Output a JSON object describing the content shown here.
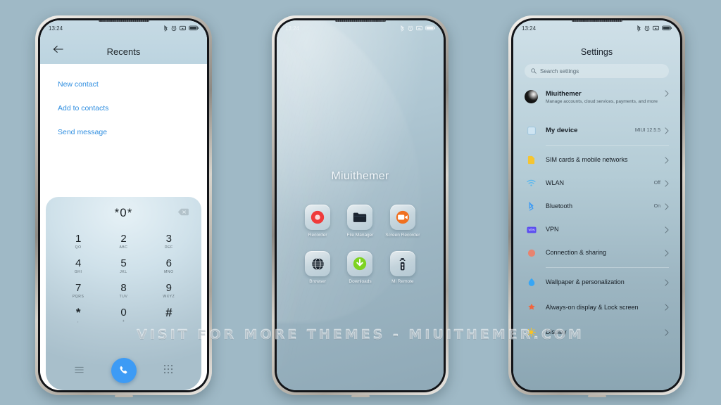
{
  "background_color": "#9fb9c6",
  "watermark": "VISIT FOR MORE THEMES - MIUITHEMER.COM",
  "status_bar": {
    "time": "13:24",
    "icons": [
      "bluetooth-icon",
      "alarm-icon",
      "screenshot-icon",
      "battery-icon"
    ]
  },
  "phone1": {
    "screen_name": "dialer-recents",
    "appbar": {
      "back_icon": "back-arrow-icon",
      "title": "Recents"
    },
    "menu_items": [
      {
        "label": "New contact"
      },
      {
        "label": "Add to contacts"
      },
      {
        "label": "Send message"
      }
    ],
    "menu_color": "#2f8ee0",
    "keypad": {
      "entered_number": "*0*",
      "delete_icon": "backspace-icon",
      "keys": [
        {
          "digit": "1",
          "letters": "QO"
        },
        {
          "digit": "2",
          "letters": "ABC"
        },
        {
          "digit": "3",
          "letters": "DEF"
        },
        {
          "digit": "4",
          "letters": "GHI"
        },
        {
          "digit": "5",
          "letters": "JKL"
        },
        {
          "digit": "6",
          "letters": "MNO"
        },
        {
          "digit": "7",
          "letters": "PQRS"
        },
        {
          "digit": "8",
          "letters": "TUV"
        },
        {
          "digit": "9",
          "letters": "WXYZ"
        },
        {
          "digit": "*",
          "letters": ","
        },
        {
          "digit": "0",
          "letters": "+"
        },
        {
          "digit": "#",
          "letters": ""
        }
      ],
      "left_icon": "menu-lines-icon",
      "call_icon": "phone-call-icon",
      "right_icon": "keypad-grid-icon",
      "call_button_color": "#3d9bf5"
    }
  },
  "phone2": {
    "screen_name": "home-screen",
    "wallpaper_title": "Miuithemer",
    "apps": [
      {
        "label": "Recorder",
        "icon": "recorder-icon",
        "color": "#ef3b3b"
      },
      {
        "label": "File Manager",
        "icon": "folder-icon",
        "color": "#1b2430"
      },
      {
        "label": "Screen Recorder",
        "icon": "screen-recorder-icon",
        "color": "#f07020"
      },
      {
        "label": "Browser",
        "icon": "globe-icon",
        "color": "#15202b"
      },
      {
        "label": "Downloads",
        "icon": "download-arrow-icon",
        "color": "#7ed321"
      },
      {
        "label": "Mi Remote",
        "icon": "remote-control-icon",
        "color": "#1b2430"
      }
    ]
  },
  "phone3": {
    "screen_name": "settings",
    "title": "Settings",
    "search": {
      "icon": "search-icon",
      "placeholder": "Search settings"
    },
    "account": {
      "avatar": "user-avatar",
      "name": "Miuithemer",
      "subtitle": "Manage accounts, cloud services, payments, and more",
      "chevron": "chevron-right-icon"
    },
    "device": {
      "icon": "device-icon",
      "label": "My device",
      "value": "MIUI 12.5.5",
      "chevron": "chevron-right-icon"
    },
    "items": [
      {
        "label": "SIM cards & mobile networks",
        "value": "",
        "icon": "sim-card-icon",
        "color": "#f5c531"
      },
      {
        "label": "WLAN",
        "value": "Off",
        "icon": "wifi-icon",
        "color": "#5ab8ef"
      },
      {
        "label": "Bluetooth",
        "value": "On",
        "icon": "bluetooth-icon",
        "color": "#3d9bf5"
      },
      {
        "label": "VPN",
        "value": "",
        "icon": "vpn-icon",
        "color": "#5b4df0"
      },
      {
        "label": "Connection & sharing",
        "value": "",
        "icon": "connection-icon",
        "color": "#e8836f"
      }
    ],
    "items2": [
      {
        "label": "Wallpaper & personalization",
        "value": "",
        "icon": "wallpaper-icon",
        "color": "#37a6f5"
      },
      {
        "label": "Always-on display & Lock screen",
        "value": "",
        "icon": "lockscreen-icon",
        "color": "#f2643c"
      },
      {
        "label": "Display",
        "value": "",
        "icon": "brightness-icon",
        "color": "#f7c325"
      }
    ]
  }
}
